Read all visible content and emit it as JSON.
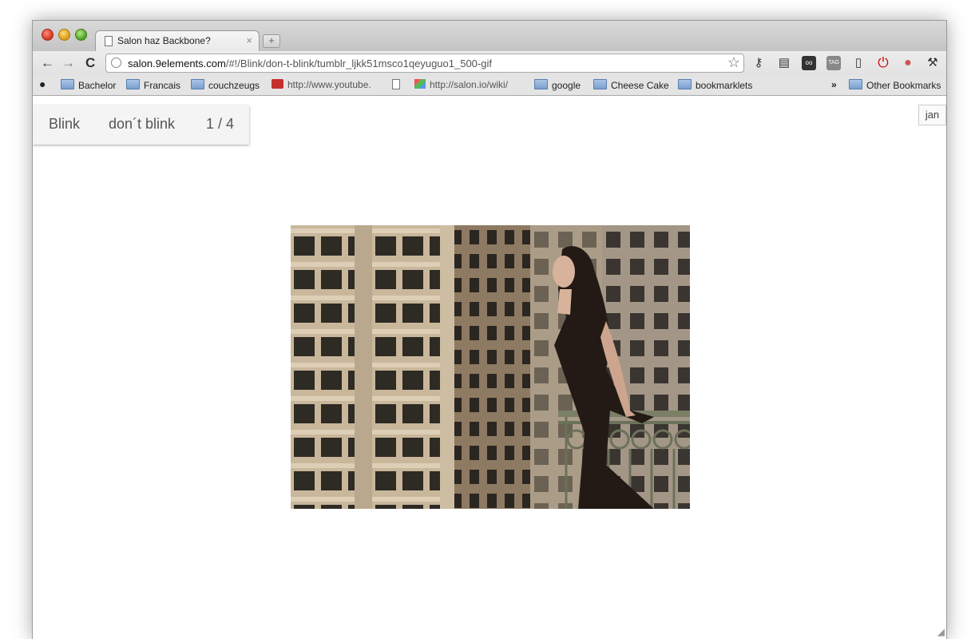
{
  "browser": {
    "tab_title": "Salon haz Backbone?",
    "tab_close": "×",
    "new_tab": "+",
    "url_host": "salon.9elements.com",
    "url_path": "/#!/Blink/don-t-blink/tumblr_ljkk51msco1qeyuguo1_500-gif",
    "nav": {
      "back": "←",
      "forward": "→",
      "reload": "C"
    }
  },
  "bookmarks": {
    "items": [
      {
        "label": "Bachelor",
        "icon": "folder-icon"
      },
      {
        "label": "Francais",
        "icon": "folder-icon"
      },
      {
        "label": "couchzeugs",
        "icon": "folder-icon"
      },
      {
        "label": "http://www.youtube.",
        "icon": "youtube-icon"
      },
      {
        "label": "http://salon.io/wiki/",
        "icon": "salon-icon"
      },
      {
        "label": "google",
        "icon": "folder-icon"
      },
      {
        "label": "Cheese Cake",
        "icon": "folder-icon"
      },
      {
        "label": "bookmarklets",
        "icon": "folder-icon"
      }
    ],
    "overflow": "»",
    "other": "Other Bookmarks"
  },
  "page": {
    "breadcrumb": {
      "gallery": "Blink",
      "album": "don´t blink",
      "counter": "1 / 4"
    },
    "user": "jan"
  },
  "colors": {
    "breadcrumb_bg": "#f4f4f4",
    "breadcrumb_text": "#555555"
  }
}
